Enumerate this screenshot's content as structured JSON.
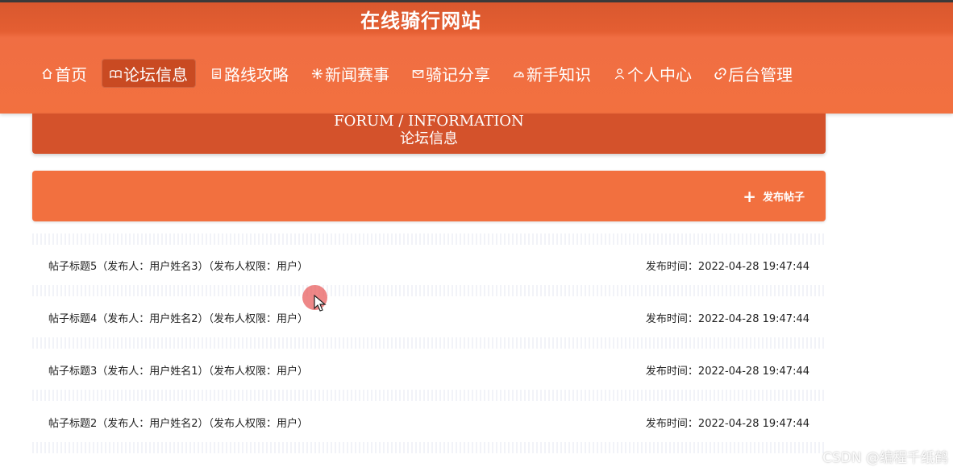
{
  "header": {
    "site_title": "在线骑行网站",
    "nav": [
      {
        "label": "首页",
        "icon": "home-icon",
        "active": false
      },
      {
        "label": "论坛信息",
        "icon": "forum-icon",
        "active": true
      },
      {
        "label": "路线攻略",
        "icon": "route-icon",
        "active": false
      },
      {
        "label": "新闻赛事",
        "icon": "news-icon",
        "active": false
      },
      {
        "label": "骑记分享",
        "icon": "mail-icon",
        "active": false
      },
      {
        "label": "新手知识",
        "icon": "dashboard-icon",
        "active": false
      },
      {
        "label": "个人中心",
        "icon": "user-icon",
        "active": false
      },
      {
        "label": "后台管理",
        "icon": "link-icon",
        "active": false
      }
    ]
  },
  "banner": {
    "title_en": "FORUM / INFORMATION",
    "title_cn": "论坛信息"
  },
  "actions": {
    "post_label": "发布帖子",
    "post_icon": "plus-icon"
  },
  "posts": [
    {
      "title": "帖子标题5（发布人：用户姓名3）（发布人权限：用户）",
      "time": "发布时间：2022-04-28 19:47:44"
    },
    {
      "title": "帖子标题4（发布人：用户姓名2）（发布人权限：用户）",
      "time": "发布时间：2022-04-28 19:47:44"
    },
    {
      "title": "帖子标题3（发布人：用户姓名1）（发布人权限：用户）",
      "time": "发布时间：2022-04-28 19:47:44"
    },
    {
      "title": "帖子标题2（发布人：用户姓名2）（发布人权限：用户）",
      "time": "发布时间：2022-04-28 19:47:44"
    }
  ],
  "watermark": "CSDN @编程千纸鹤",
  "colors": {
    "header_dark": "#d9582e",
    "header_main": "#f2703f",
    "banner": "#d4522b",
    "nav_active": "#c94a22"
  }
}
